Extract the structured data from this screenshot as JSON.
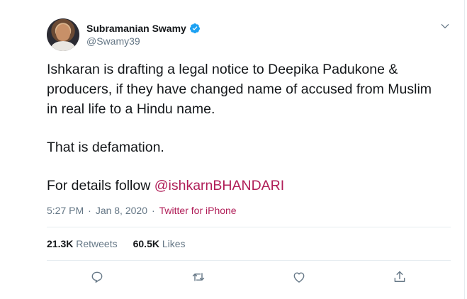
{
  "author": {
    "name": "Subramanian Swamy",
    "handle": "@Swamy39",
    "verified": true
  },
  "tweet": {
    "line1": "Ishkaran is drafting a legal notice to Deepika Padukone & producers, if they have changed name of accused from Muslim in real life to a Hindu name.",
    "line2": "That is defamation.",
    "line3_prefix": "For details follow ",
    "line3_mention": "@ishkarnBHANDARI"
  },
  "meta": {
    "time": "5:27 PM",
    "date": "Jan 8, 2020",
    "separator": "·",
    "source": "Twitter for iPhone"
  },
  "stats": {
    "retweets_count": "21.3K",
    "retweets_label": "Retweets",
    "likes_count": "60.5K",
    "likes_label": "Likes"
  },
  "colors": {
    "text": "#14171a",
    "muted": "#657786",
    "link": "#b01e58",
    "verified": "#1da1f2",
    "divider": "#e6ecf0"
  },
  "icons": [
    "chevron-down-icon",
    "verified-badge-icon",
    "reply-icon",
    "retweet-icon",
    "like-icon",
    "share-icon"
  ]
}
